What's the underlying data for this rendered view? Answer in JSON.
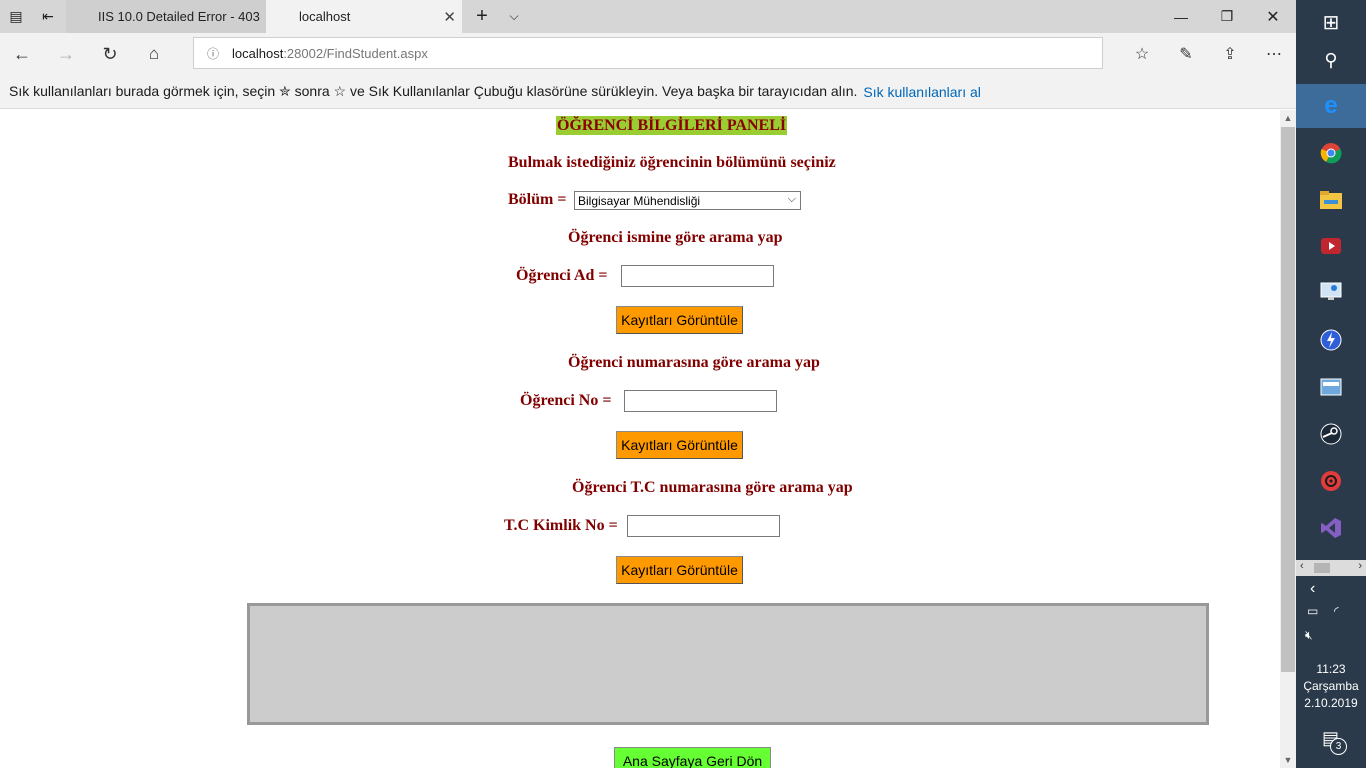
{
  "browser": {
    "tabs": [
      {
        "title": "IIS 10.0 Detailed Error - 403",
        "active": false
      },
      {
        "title": "localhost",
        "active": true
      }
    ],
    "url_host": "localhost",
    "url_path": ":28002/FindStudent.aspx",
    "favorites_hint": "Sık kullanılanları burada görmek için, seçin  ✮  sonra ☆ ve Sık Kullanılanlar Çubuğu klasörüne sürükleyin. Veya başka bir tarayıcıdan alın.",
    "favorites_link": "Sık kullanılanları al"
  },
  "page": {
    "panel_title": "ÖĞRENCİ BİLGİLERİ PANELİ",
    "section_department": "Bulmak istediğiniz öğrencinin bölümünü seçiniz",
    "department_label": "Bölüm =",
    "department_selected": "Bilgisayar Mühendisliği",
    "section_name": "Öğrenci ismine göre arama yap",
    "name_label": "Öğrenci Ad =",
    "name_value": "",
    "button_show_1": "Kayıtları Görüntüle",
    "section_number": "Öğrenci numarasına göre arama yap",
    "number_label": "Öğrenci No =",
    "number_value": "",
    "button_show_2": "Kayıtları Görüntüle",
    "section_tc": "Öğrenci T.C numarasına göre arama yap",
    "tc_label": "T.C Kimlik No =",
    "tc_value": "",
    "button_show_3": "Kayıtları Görüntüle",
    "back_button": "Ana Sayfaya Geri Dön"
  },
  "colors": {
    "label_color": "#800000",
    "panel_title_bg": "#9acd32",
    "show_button_bg": "#ff9900",
    "back_button_bg": "#66ff33",
    "results_box_bg": "#cccccc"
  },
  "taskbar": {
    "time": "11:23",
    "day": "Çarşamba",
    "date": "2.10.2019",
    "notification_count": "3",
    "icons": [
      "windows-start-icon",
      "search-icon",
      "edge-icon",
      "chrome-icon",
      "file-explorer-icon",
      "media-player-icon",
      "remote-desktop-icon",
      "app-icon",
      "window-app-icon",
      "steam-icon",
      "target-app-icon",
      "visual-studio-icon"
    ]
  }
}
